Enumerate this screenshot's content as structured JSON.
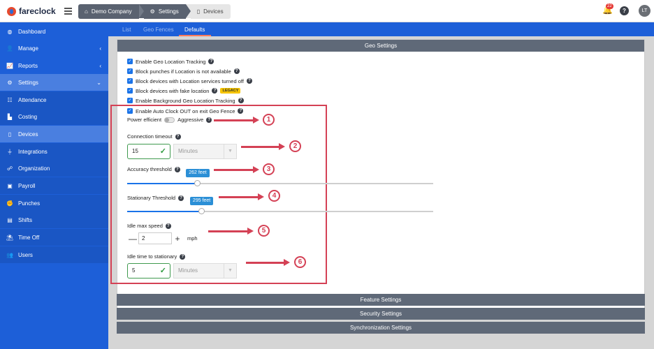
{
  "app": {
    "name": "fareclock"
  },
  "breadcrumb": {
    "items": [
      "Demo Company",
      "Settings",
      "Devices"
    ]
  },
  "topbar": {
    "notifications_count": "22",
    "help": "?",
    "avatar_initials": "LT"
  },
  "sidebar": {
    "items": [
      {
        "label": "Dashboard",
        "icon": "dashboard-icon"
      },
      {
        "label": "Manage",
        "icon": "person-icon",
        "caret": "‹"
      },
      {
        "label": "Reports",
        "icon": "chart-icon",
        "caret": "‹"
      },
      {
        "label": "Settings",
        "icon": "gear-icon",
        "caret": "⌄"
      },
      {
        "label": "Attendance",
        "icon": "attendance-icon"
      },
      {
        "label": "Costing",
        "icon": "costing-icon"
      },
      {
        "label": "Devices",
        "icon": "phone-icon"
      },
      {
        "label": "Integrations",
        "icon": "plug-icon"
      },
      {
        "label": "Organization",
        "icon": "org-icon"
      },
      {
        "label": "Payroll",
        "icon": "payroll-icon"
      },
      {
        "label": "Punches",
        "icon": "punches-icon"
      },
      {
        "label": "Shifts",
        "icon": "shifts-icon"
      },
      {
        "label": "Time Off",
        "icon": "timeoff-icon"
      },
      {
        "label": "Users",
        "icon": "users-icon"
      }
    ]
  },
  "tabs": [
    "List",
    "Geo Fences",
    "Defaults"
  ],
  "geo": {
    "header": "Geo Settings",
    "checkboxes": [
      "Enable Geo Location Tracking",
      "Block punches if Location is not available",
      "Block devices with Location services turned off",
      "Block devices with fake location",
      "Enable Background Geo Location Tracking",
      "Enable Auto Clock OUT on exit Geo Fence"
    ],
    "legacy_badge": "LEGACY",
    "power_left": "Power efficient",
    "power_right": "Aggressive",
    "connection_timeout": {
      "label": "Connection timeout",
      "value": "15",
      "unit": "Minutes"
    },
    "accuracy": {
      "label": "Accuracy threshold",
      "tip": "262 feet",
      "fraction": 0.23
    },
    "stationary": {
      "label": "Stationary Threshold",
      "tip": "295 feet",
      "fraction": 0.243
    },
    "idle_speed": {
      "label": "Idle max speed",
      "value": "2",
      "unit": "mph",
      "minus": "—",
      "plus": "+"
    },
    "idle_time": {
      "label": "Idle time to stationary",
      "value": "5",
      "unit": "Minutes"
    }
  },
  "annotations": [
    "1",
    "2",
    "3",
    "4",
    "5",
    "6"
  ],
  "sections": [
    "Feature Settings",
    "Security Settings",
    "Synchronization Settings"
  ],
  "colors": {
    "brand": "#1d5fd8",
    "annotation": "#d44155",
    "header": "#5f6978"
  }
}
